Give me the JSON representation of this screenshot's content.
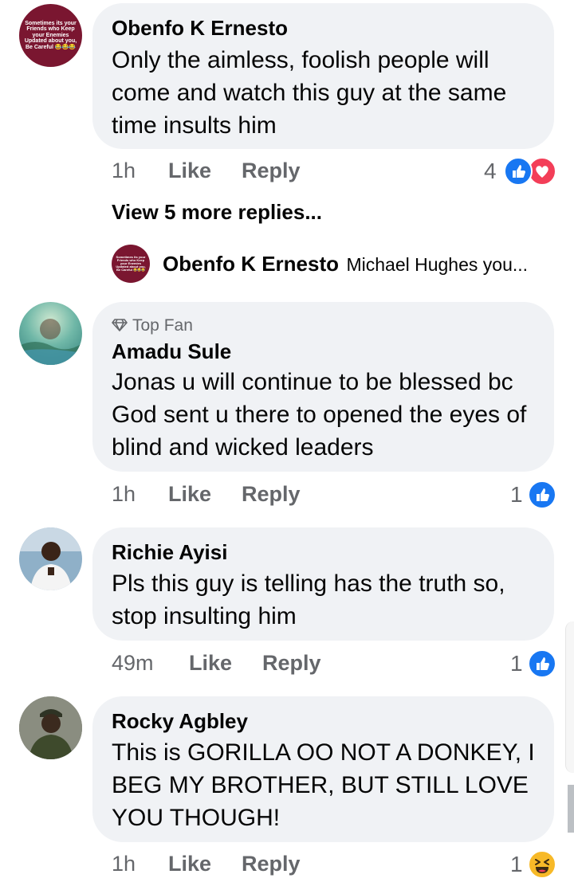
{
  "comments": [
    {
      "author": "Obenfo K Ernesto",
      "text": "Only the aimless, foolish people will come and watch this guy at the same time insults him",
      "time": "1h",
      "like": "Like",
      "reply": "Reply",
      "reaction_count": "4",
      "reactions": [
        "like-icon",
        "love-icon"
      ],
      "avatar_text": "Sometimes its your Friends who Keep your Enemies Updated about you, Be Careful 😂😂😂",
      "view_more": "View 5 more replies...",
      "reply_preview": {
        "author": "Obenfo K Ernesto",
        "text": "Michael Hughes you..."
      }
    },
    {
      "badge": "Top Fan",
      "author": "Amadu Sule",
      "text": "Jonas u will continue to be blessed bc God sent u there to opened the eyes of blind and wicked leaders",
      "time": "1h",
      "like": "Like",
      "reply": "Reply",
      "reaction_count": "1",
      "reactions": [
        "like-icon"
      ]
    },
    {
      "author": "Richie Ayisi",
      "text": "Pls this guy is telling has the truth so, stop insulting him",
      "time": "49m",
      "like": "Like",
      "reply": "Reply",
      "reaction_count": "1",
      "reactions": [
        "like-icon"
      ]
    },
    {
      "author": "Rocky Agbley",
      "text": "This is GORILLA  OO NOT A DONKEY, I BEG MY BROTHER,  BUT STILL LOVE YOU THOUGH!",
      "time": "1h",
      "like": "Like",
      "reply": "Reply",
      "reaction_count": "1",
      "reactions": [
        "haha-icon"
      ]
    }
  ],
  "colors": {
    "bubble": "#f0f2f5",
    "secondary_text": "#65676b",
    "like_blue": "#1877f2",
    "love_red": "#f33e58",
    "haha_yellow": "#f7b928"
  }
}
